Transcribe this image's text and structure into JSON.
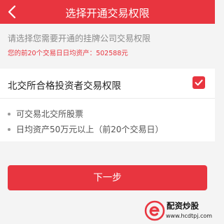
{
  "header": {
    "title": "选择开通交易权限",
    "back_icon": "chevron-left-icon"
  },
  "notice": {
    "hint": "请选择您需要开通的挂牌公司交易权限",
    "assets_label": "您的前20个交易日日均资产：",
    "assets_value": "502588元"
  },
  "permission": {
    "title": "北交所合格投资者交易权限",
    "checked": true,
    "bullets": [
      "可交易北交所股票",
      "日均资产50万元以上（前20个交易日）"
    ]
  },
  "actions": {
    "next_label": "下一步"
  },
  "watermark": {
    "name": "配资炒股",
    "url": "www.hcdtpj.com",
    "logo_letter": "e"
  },
  "colors": {
    "accent": "#e8353f",
    "background": "#f4f4f4",
    "hint_text": "#8a8a8a"
  }
}
